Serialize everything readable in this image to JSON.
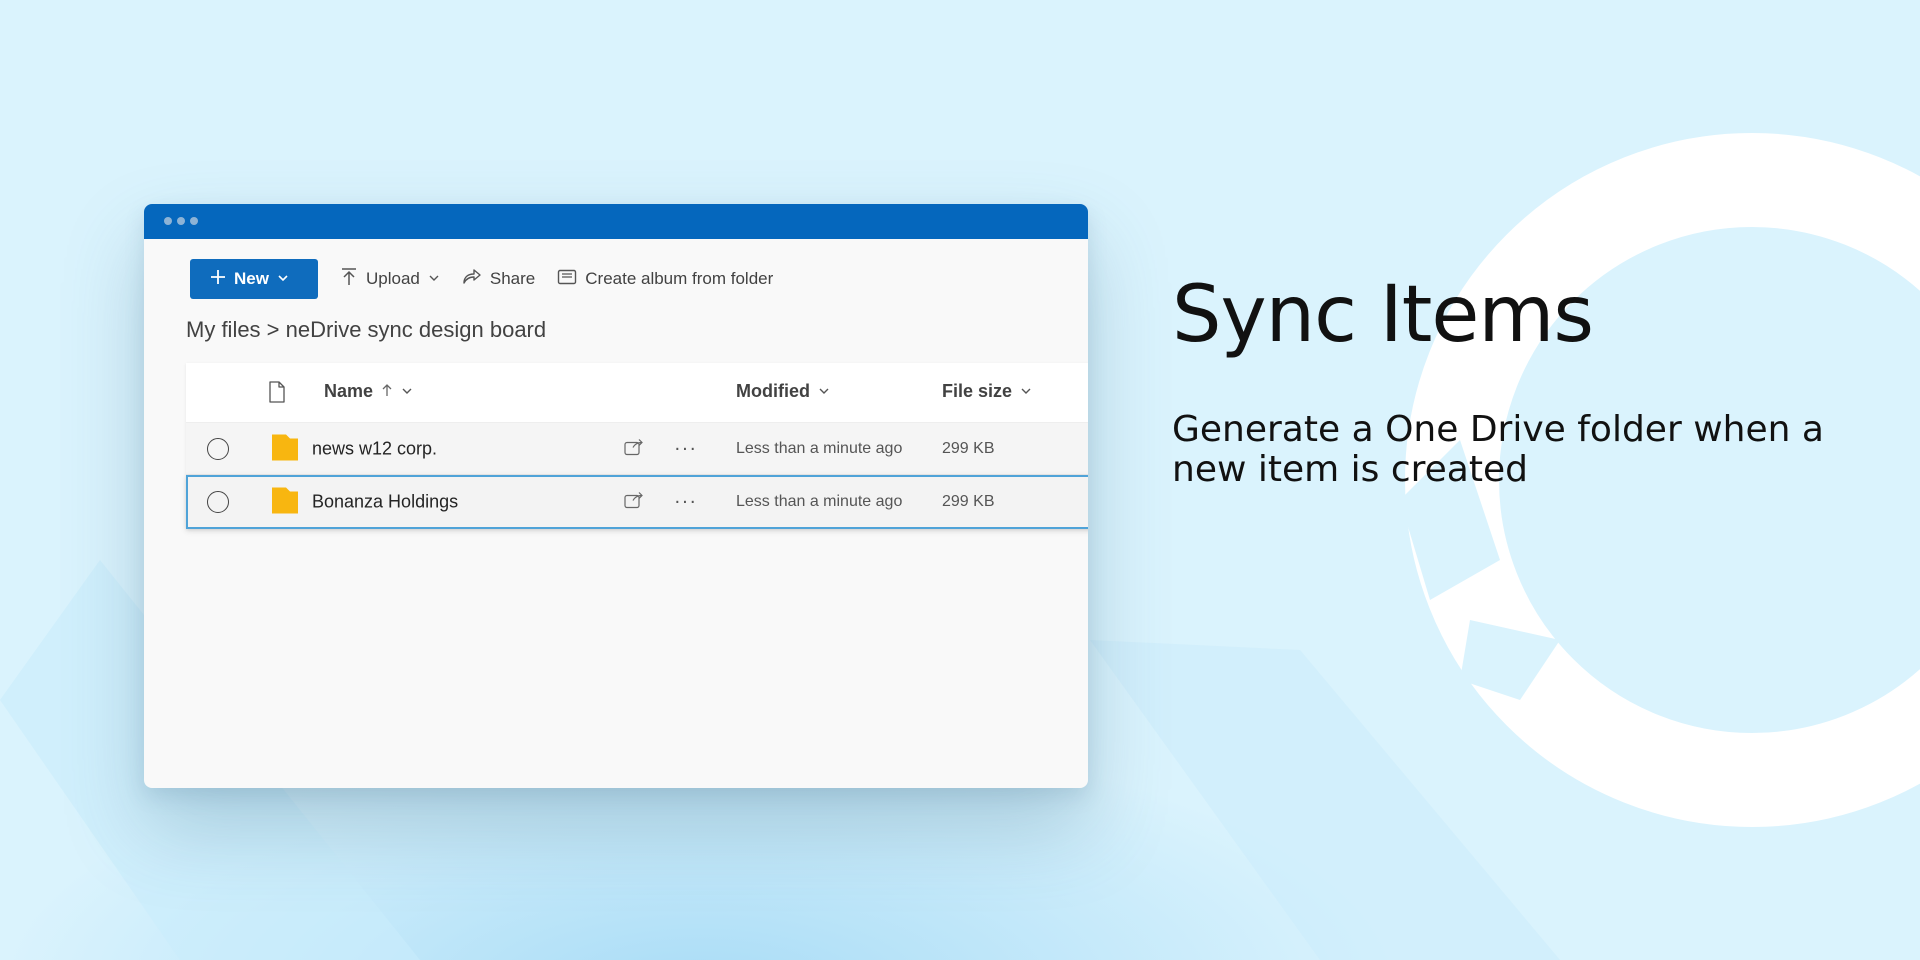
{
  "toolbar": {
    "new_label": "New",
    "upload_label": "Upload",
    "share_label": "Share",
    "album_label": "Create album from folder"
  },
  "breadcrumb": "My files > neDrive sync design board",
  "columns": {
    "name": "Name",
    "modified": "Modified",
    "size": "File size"
  },
  "rows": [
    {
      "name": "news w12 corp.",
      "modified": "Less than a minute ago",
      "size": "299 KB"
    },
    {
      "name": "Bonanza Holdings",
      "modified": "Less than a minute ago",
      "size": "299 KB"
    }
  ],
  "hero": {
    "title": "Sync Items",
    "subtitle": "Generate a One Drive folder when a new item is created"
  },
  "colors": {
    "titlebar": "#0567bd",
    "accent": "#0f6cbd",
    "folder": "#f8b610",
    "background": "#daf3fd"
  }
}
